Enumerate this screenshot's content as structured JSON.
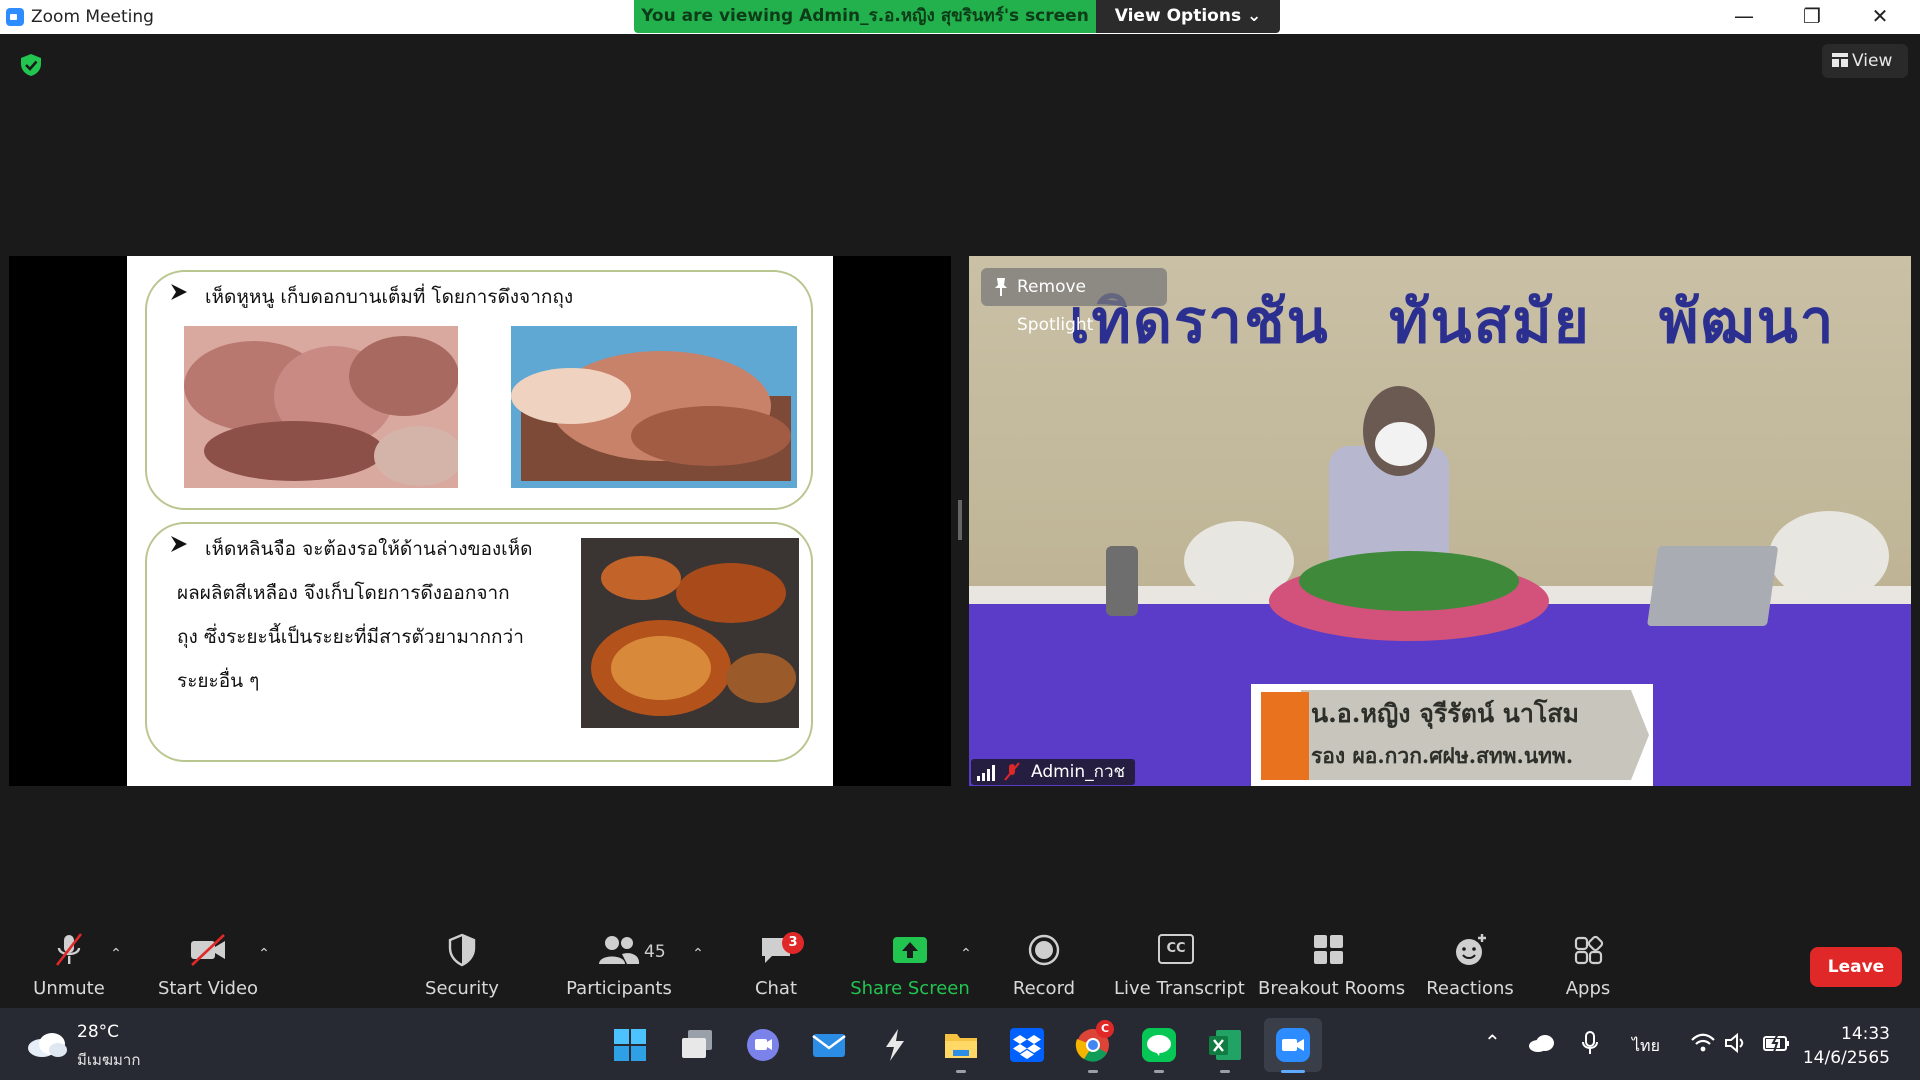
{
  "titlebar": {
    "title": "Zoom Meeting",
    "viewing_banner": "You are viewing Admin_ร.อ.หญิง สุขรินทร์'s screen",
    "view_options": "View Options ⌄",
    "minimize": "—",
    "restore": "❐",
    "close": "✕"
  },
  "view_button": {
    "label": "View"
  },
  "slide": {
    "bullet1": "เห็ดหูหนู เก็บดอกบานเต็มที่ โดยการดึงจากถุง",
    "bullet2_lines": [
      "เห็ดหลินจือ จะต้องรอให้ด้านล่างของเห็ด",
      "ผลผลิตสีเหลือง จึงเก็บโดยการดึงออกจาก",
      "ถุง ซึ่งระยะนี้เป็นระยะที่มีสารตัวยามากกว่า",
      "ระยะอื่น ๆ"
    ]
  },
  "video": {
    "banner_words": [
      "เทิดราชัน",
      "ทันสมัย",
      "พัฒนา"
    ],
    "remove_spotlight": "Remove Spotlight",
    "participant_name": "Admin_กวช",
    "lower_third_line1": "น.อ.หญิง จุรีรัตน์  นาโสม",
    "lower_third_line2": "รอง ผอ.กวก.ศฝษ.สทพ.นทพ."
  },
  "toolbar": {
    "unmute": "Unmute",
    "start_video": "Start Video",
    "security": "Security",
    "participants": "Participants",
    "participants_count": "45",
    "chat": "Chat",
    "chat_badge": "3",
    "share_screen": "Share Screen",
    "record": "Record",
    "live_transcript": "Live Transcript",
    "cc_label": "CC",
    "breakout_rooms": "Breakout Rooms",
    "reactions": "Reactions",
    "apps": "Apps",
    "leave": "Leave"
  },
  "taskbar": {
    "weather_temp": "28°C",
    "weather_desc": "มีเมฆมาก",
    "language": "ไทย",
    "time": "14:33",
    "date": "14/6/2565",
    "chrome_badge": "C"
  },
  "colors": {
    "zoom_blue": "#2d8cff",
    "banner_green": "#23b14d",
    "share_green": "#23c551",
    "leave_red": "#e02828"
  }
}
